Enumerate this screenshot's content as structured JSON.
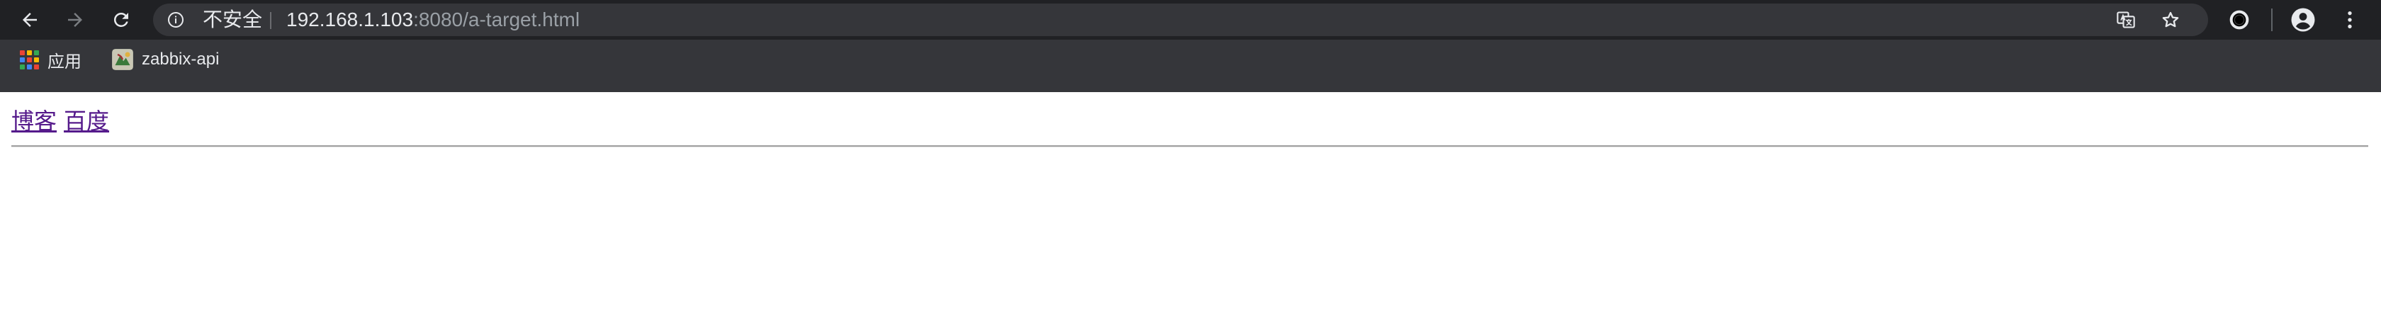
{
  "browser": {
    "security_label": "不安全",
    "url_host": "192.168.1.103",
    "url_rest": ":8080/a-target.html"
  },
  "bookmarks": [
    {
      "label": "应用",
      "icon": "apps-grid-icon"
    },
    {
      "label": "zabbix-api",
      "icon": "zabbix-favicon"
    }
  ],
  "page": {
    "links": [
      "博客",
      "百度"
    ]
  },
  "colors": {
    "toolbar_bg": "#202124",
    "omnibox_bg": "#35363a",
    "bookmarks_bg": "#35363a",
    "visited_link": "#551a8b",
    "apps_grid": [
      "#ea4335",
      "#fbbc04",
      "#34a853",
      "#4285f4",
      "#ea4335",
      "#fbbc04",
      "#34a853",
      "#4285f4",
      "#ea4335"
    ]
  }
}
